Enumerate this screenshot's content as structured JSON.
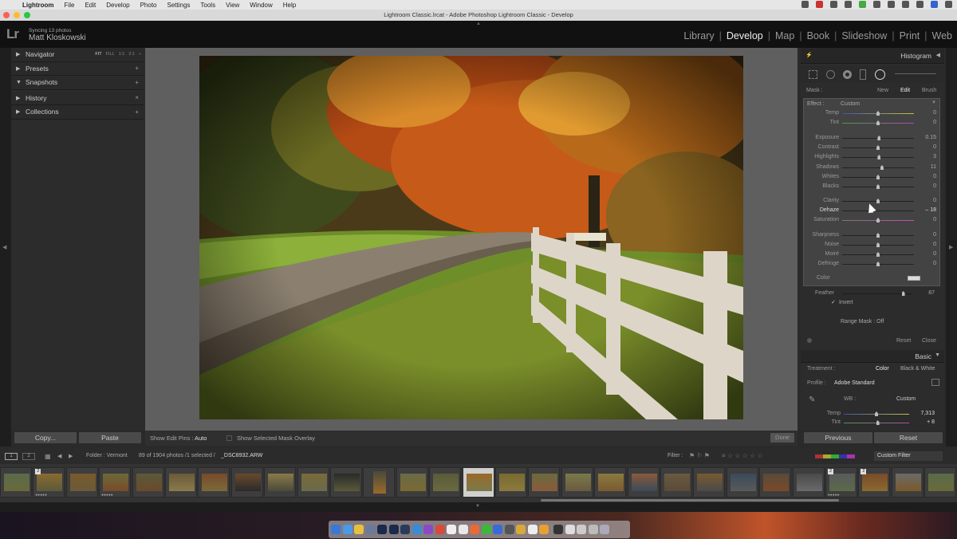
{
  "menubar": {
    "app": "Lightroom",
    "items": [
      "File",
      "Edit",
      "Develop",
      "Photo",
      "Settings",
      "Tools",
      "View",
      "Window",
      "Help"
    ]
  },
  "window": {
    "title": "Lightroom Classic.lrcat - Adobe Photoshop Lightroom Classic - Develop"
  },
  "identity": {
    "logo": "Lr",
    "sync": "Syncing 13 photos",
    "user": "Matt Kloskowski"
  },
  "modules": [
    "Library",
    "Develop",
    "Map",
    "Book",
    "Slideshow",
    "Print",
    "Web"
  ],
  "modules_active": "Develop",
  "left_panels": [
    {
      "label": "Navigator",
      "action": ""
    },
    {
      "label": "Presets",
      "action": "+"
    },
    {
      "label": "Snapshots",
      "action": "+"
    },
    {
      "label": "History",
      "action": "×"
    },
    {
      "label": "Collections",
      "action": "+"
    }
  ],
  "navigator_options": [
    "FIT",
    "FILL",
    "1:1",
    "2:1",
    "÷"
  ],
  "left_buttons": {
    "copy": "Copy...",
    "paste": "Paste"
  },
  "toolbar": {
    "edit_pins_label": "Show Edit Pins :",
    "edit_pins_value": "Auto",
    "overlay_label": "Show Selected Mask Overlay",
    "done": "Done"
  },
  "right": {
    "histogram": "Histogram",
    "mask": {
      "label": "Mask :",
      "new": "New",
      "edit": "Edit",
      "brush": "Brush"
    },
    "effect": {
      "label": "Effect :",
      "value": "Custom"
    },
    "sliders": [
      {
        "label": "Temp",
        "value": "0",
        "pos": 0.5
      },
      {
        "label": "Tint",
        "value": "0",
        "pos": 0.5
      },
      {
        "label": "Exposure",
        "value": "0.15",
        "pos": 0.515
      },
      {
        "label": "Contrast",
        "value": "0",
        "pos": 0.5
      },
      {
        "label": "Highlights",
        "value": "3",
        "pos": 0.515
      },
      {
        "label": "Shadows",
        "value": "11",
        "pos": 0.555
      },
      {
        "label": "Whites",
        "value": "0",
        "pos": 0.5
      },
      {
        "label": "Blacks",
        "value": "0",
        "pos": 0.5
      },
      {
        "label": "Clarity",
        "value": "0",
        "pos": 0.5
      },
      {
        "label": "Dehaze",
        "value": "– 18",
        "pos": 0.41
      },
      {
        "label": "Saturation",
        "value": "0",
        "pos": 0.5
      },
      {
        "label": "Sharpness",
        "value": "0",
        "pos": 0.5
      },
      {
        "label": "Noise",
        "value": "0",
        "pos": 0.5
      },
      {
        "label": "Moiré",
        "value": "0",
        "pos": 0.5
      },
      {
        "label": "Defringe",
        "value": "0",
        "pos": 0.5
      }
    ],
    "color_label": "Color",
    "feather": {
      "label": "Feather",
      "value": "87",
      "pos": 0.87
    },
    "invert": "Invert",
    "range_mask": "Range Mask : Off",
    "reset": "Reset",
    "close": "Close",
    "basic": "Basic",
    "treatment": {
      "label": "Treatment :",
      "color": "Color",
      "bw": "Black & White"
    },
    "profile": {
      "label": "Profile :",
      "value": "Adobe Standard"
    },
    "wb": {
      "label": "WB :",
      "value": "Custom"
    },
    "temp": {
      "label": "Temp",
      "value": "7,313",
      "pos": 0.5
    },
    "tint": {
      "label": "Tint",
      "value": "+ 8",
      "pos": 0.52
    }
  },
  "right_buttons": {
    "previous": "Previous",
    "reset": "Reset"
  },
  "filmstrip_bar": {
    "folder": "Folder : Vermont",
    "count": "89 of 1904 photos /1 selected /",
    "file": "_DSC8932.ARW",
    "filter_label": "Filter :",
    "custom_filter": "Custom Filter",
    "page1": "1",
    "page2": "2"
  },
  "thumb_badges": [
    "2",
    "2",
    "2"
  ],
  "colors": {
    "accent": "#e8e8e8",
    "panel": "#2c2c2c",
    "center": "#5f5f5f"
  }
}
